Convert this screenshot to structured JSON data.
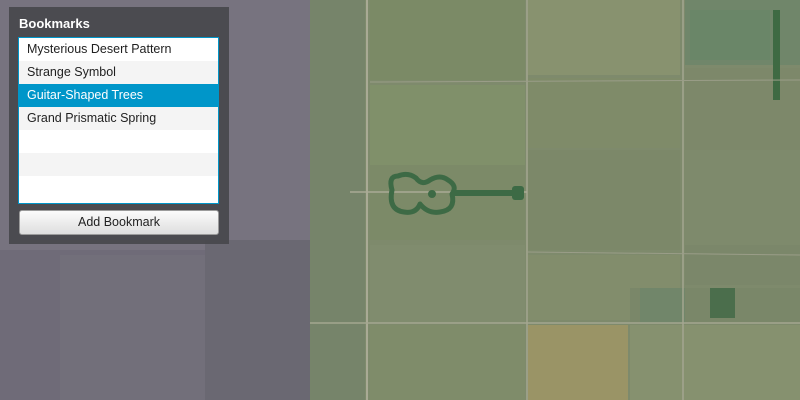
{
  "panel": {
    "title": "Bookmarks",
    "items": [
      {
        "label": "Mysterious Desert Pattern",
        "selected": false
      },
      {
        "label": "Strange Symbol",
        "selected": false
      },
      {
        "label": "Guitar-Shaped Trees",
        "selected": true
      },
      {
        "label": "Grand Prismatic Spring",
        "selected": false
      }
    ],
    "add_button_label": "Add Bookmark"
  },
  "colors": {
    "selection": "#0096c9",
    "panel_background": "#46464a",
    "farmland": "#7d876f"
  }
}
